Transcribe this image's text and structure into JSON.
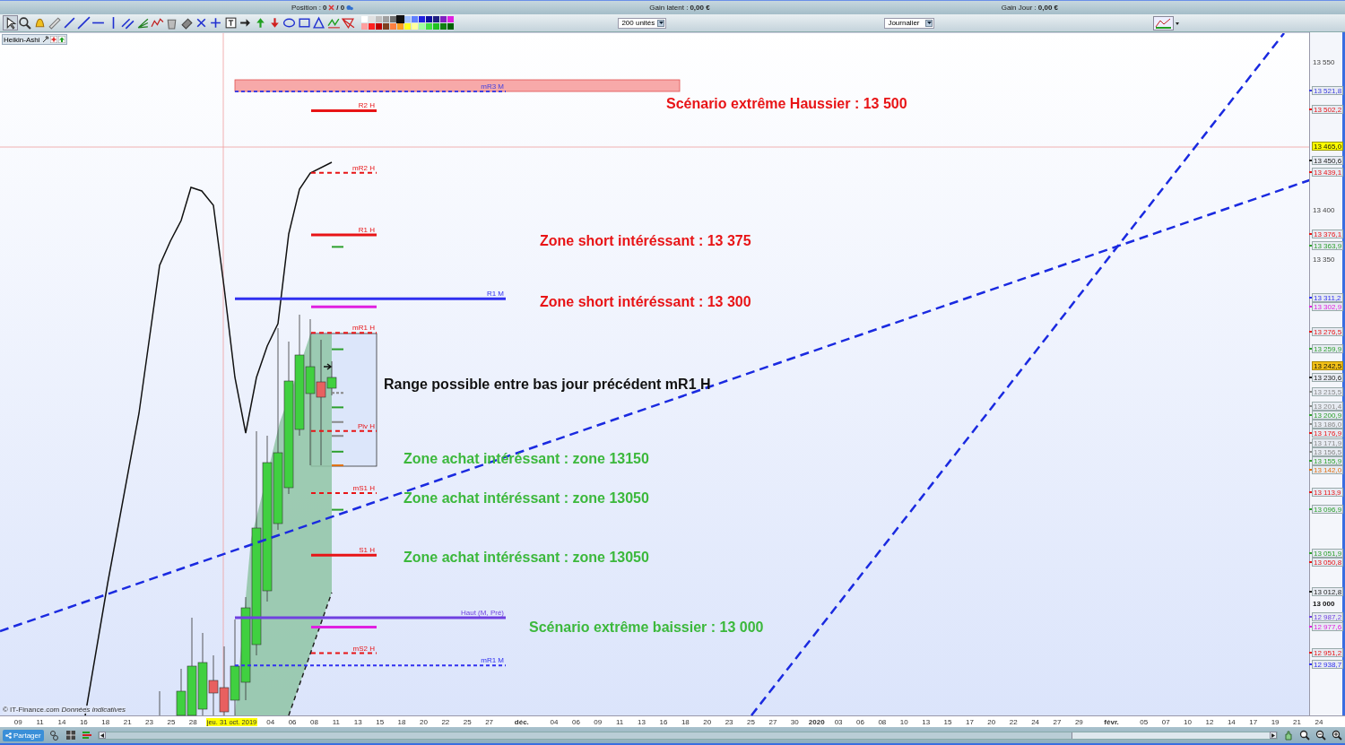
{
  "status": {
    "position_label": "Position :",
    "position_value": "0",
    "position_total": "/ 0",
    "gain_latent_label": "Gain latent :",
    "gain_latent_value": "0,00 €",
    "gain_jour_label": "Gain Jour :",
    "gain_jour_value": "0,00 €"
  },
  "palette": [
    {
      "color": "#ffffff",
      "selected": false
    },
    {
      "color": "#e0e0e0",
      "selected": false
    },
    {
      "color": "#c0c0c0",
      "selected": false
    },
    {
      "color": "#a0a0a0",
      "selected": false
    },
    {
      "color": "#707070",
      "selected": false
    },
    {
      "color": "#101010",
      "selected": true
    },
    {
      "color": "#a0c0ff",
      "selected": false
    },
    {
      "color": "#6080ff",
      "selected": false
    },
    {
      "color": "#2020e0",
      "selected": false
    },
    {
      "color": "#1010a0",
      "selected": false
    },
    {
      "color": "#202080",
      "selected": false
    },
    {
      "color": "#8020c0",
      "selected": false
    },
    {
      "color": "#e020e0",
      "selected": false
    },
    {
      "color": "#ffa0a0",
      "selected": false
    },
    {
      "color": "#ff2020",
      "selected": false
    },
    {
      "color": "#c00000",
      "selected": false
    },
    {
      "color": "#804020",
      "selected": false
    },
    {
      "color": "#ff8040",
      "selected": false
    },
    {
      "color": "#ffa020",
      "selected": false
    },
    {
      "color": "#ffff20",
      "selected": false
    },
    {
      "color": "#ffffa0",
      "selected": false
    },
    {
      "color": "#a0ffa0",
      "selected": false
    },
    {
      "color": "#40e040",
      "selected": false
    },
    {
      "color": "#20c020",
      "selected": false
    },
    {
      "color": "#108010",
      "selected": false
    },
    {
      "color": "#006000",
      "selected": false
    }
  ],
  "quantity_select": {
    "value": "200 unités"
  },
  "period_select": {
    "value": "Journalier"
  },
  "chart": {
    "tag": "Heikin-Ashi",
    "copyright": "© IT-Finance.com *Données indicatives*",
    "annotations": [
      {
        "text": "Scénario extrême Haussier : 13 500",
        "color": "#e81416"
      },
      {
        "text": "Zone short intéréssant : 13 375",
        "color": "#e81416"
      },
      {
        "text": "Zone short intéréssant : 13 300",
        "color": "#e81416"
      },
      {
        "text": "Range possible entre bas jour précédent mR1 H",
        "color": "#111111"
      },
      {
        "text": "Zone achat intéréssant : zone 13150",
        "color": "#3cb83c"
      },
      {
        "text": "Zone achat intéréssant : zone 13050",
        "color": "#3cb83c"
      },
      {
        "text": "Zone achat intéréssant : zone 13050",
        "color": "#3cb83c"
      },
      {
        "text": "Scénario extrême baissier : 13 000",
        "color": "#3cb83c"
      }
    ]
  },
  "price_axis": [
    {
      "label": "13 550",
      "kind": "tick"
    },
    {
      "label": "13 521,8",
      "kind": "label",
      "color": "#4040e0",
      "line": {
        "label": "mR3 M",
        "kind": "mdashed"
      }
    },
    {
      "label": "13 502,2",
      "kind": "label",
      "color": "#e81416",
      "line": {
        "label": "R2 H",
        "kind": "hsolid"
      }
    },
    {
      "label": "13 465,0",
      "kind": "cursor"
    },
    {
      "label": "13 450,6",
      "kind": "label",
      "color": "#222222"
    },
    {
      "label": "13 439,1",
      "kind": "label",
      "color": "#e81416",
      "line": {
        "label": "mR2 H",
        "kind": "hdashed"
      }
    },
    {
      "label": "13 400",
      "kind": "tick"
    },
    {
      "label": "13 376,1",
      "kind": "label",
      "color": "#e81416",
      "line": {
        "label": "R1 H",
        "kind": "hsolid"
      }
    },
    {
      "label": "13 363,9",
      "kind": "label",
      "color": "#2ca02c",
      "line": {
        "kind": "tick"
      }
    },
    {
      "label": "13 350",
      "kind": "tick"
    },
    {
      "label": "13 311,2",
      "kind": "label",
      "color": "#3030f0",
      "line": {
        "label": "R1 M",
        "kind": "msolid"
      }
    },
    {
      "label": "13 302,9",
      "kind": "label",
      "color": "#e020e0",
      "line": {
        "kind": "hsolid"
      }
    },
    {
      "label": "13 276,5",
      "kind": "label",
      "color": "#e81416",
      "line": {
        "label": "mR1 H",
        "kind": "hdashed"
      }
    },
    {
      "label": "13 259,9",
      "kind": "label",
      "color": "#2ca02c",
      "line": {
        "kind": "tick"
      }
    },
    {
      "label": "13 242,5",
      "kind": "last"
    },
    {
      "label": "13 230,6",
      "kind": "label",
      "color": "#222222"
    },
    {
      "label": "13 215,5",
      "kind": "label",
      "color": "#888888",
      "line": {
        "kind": "tickdashed"
      }
    },
    {
      "label": "13 201,4",
      "kind": "label",
      "color": "#888888"
    },
    {
      "label": "13 200,9",
      "kind": "label",
      "color": "#2ca02c",
      "line": {
        "kind": "tick"
      }
    },
    {
      "label": "13 186,0",
      "kind": "label",
      "color": "#888888",
      "line": {
        "kind": "tick"
      }
    },
    {
      "label": "13 176,9",
      "kind": "label",
      "color": "#e81416",
      "line": {
        "label": "Piv H",
        "kind": "hdashed"
      }
    },
    {
      "label": "13 171,9",
      "kind": "label",
      "color": "#888888",
      "line": {
        "kind": "tick"
      }
    },
    {
      "label": "13 156,5",
      "kind": "label",
      "color": "#888888"
    },
    {
      "label": "13 155,9",
      "kind": "label",
      "color": "#2ca02c",
      "line": {
        "kind": "tick"
      }
    },
    {
      "label": "13 142,0",
      "kind": "label",
      "color": "#e07010",
      "line": {
        "kind": "tick"
      }
    },
    {
      "label": "13 113,9",
      "kind": "label",
      "color": "#e81416",
      "line": {
        "label": "mS1 H",
        "kind": "hdashed"
      }
    },
    {
      "label": "13 096,9",
      "kind": "label",
      "color": "#2ca02c",
      "line": {
        "kind": "tick"
      }
    },
    {
      "label": "13 051,9",
      "kind": "label",
      "color": "#2ca02c"
    },
    {
      "label": "13 050,8",
      "kind": "label",
      "color": "#e81416",
      "line": {
        "label": "S1 H",
        "kind": "hsolid"
      }
    },
    {
      "label": "13 012,8",
      "kind": "label",
      "color": "#222222"
    },
    {
      "label": "13 000",
      "kind": "major"
    },
    {
      "label": "12 987,2",
      "kind": "label",
      "color": "#7040e0",
      "line": {
        "label": "Haut (M, Pré)",
        "kind": "msolid"
      }
    },
    {
      "label": "12 977,6",
      "kind": "label",
      "color": "#e020e0",
      "line": {
        "kind": "hsolid"
      }
    },
    {
      "label": "12 951,2",
      "kind": "label",
      "color": "#e81416",
      "line": {
        "label": "mS2 H",
        "kind": "hdashed"
      }
    },
    {
      "label": "12 938,7",
      "kind": "label",
      "color": "#3030f0",
      "line": {
        "label": "mR1 M",
        "kind": "mdashed"
      }
    }
  ],
  "date_axis": [
    {
      "label": "09",
      "kind": "day"
    },
    {
      "label": "11",
      "kind": "day"
    },
    {
      "label": "14",
      "kind": "day"
    },
    {
      "label": "16",
      "kind": "day"
    },
    {
      "label": "18",
      "kind": "day"
    },
    {
      "label": "21",
      "kind": "day"
    },
    {
      "label": "23",
      "kind": "day"
    },
    {
      "label": "25",
      "kind": "day"
    },
    {
      "label": "28",
      "kind": "day"
    },
    {
      "label": "jeu. 31 oct. 2019",
      "kind": "cursor"
    },
    {
      "label": "04",
      "kind": "day"
    },
    {
      "label": "06",
      "kind": "day"
    },
    {
      "label": "08",
      "kind": "day"
    },
    {
      "label": "11",
      "kind": "day"
    },
    {
      "label": "13",
      "kind": "day"
    },
    {
      "label": "15",
      "kind": "day"
    },
    {
      "label": "18",
      "kind": "day"
    },
    {
      "label": "20",
      "kind": "day"
    },
    {
      "label": "22",
      "kind": "day"
    },
    {
      "label": "25",
      "kind": "day"
    },
    {
      "label": "27",
      "kind": "day"
    },
    {
      "label": "déc.",
      "kind": "month"
    },
    {
      "label": "04",
      "kind": "day"
    },
    {
      "label": "06",
      "kind": "day"
    },
    {
      "label": "09",
      "kind": "day"
    },
    {
      "label": "11",
      "kind": "day"
    },
    {
      "label": "13",
      "kind": "day"
    },
    {
      "label": "16",
      "kind": "day"
    },
    {
      "label": "18",
      "kind": "day"
    },
    {
      "label": "20",
      "kind": "day"
    },
    {
      "label": "23",
      "kind": "day"
    },
    {
      "label": "25",
      "kind": "day"
    },
    {
      "label": "27",
      "kind": "day"
    },
    {
      "label": "30",
      "kind": "day"
    },
    {
      "label": "2020",
      "kind": "year"
    },
    {
      "label": "03",
      "kind": "day"
    },
    {
      "label": "06",
      "kind": "day"
    },
    {
      "label": "08",
      "kind": "day"
    },
    {
      "label": "10",
      "kind": "day"
    },
    {
      "label": "13",
      "kind": "day"
    },
    {
      "label": "15",
      "kind": "day"
    },
    {
      "label": "17",
      "kind": "day"
    },
    {
      "label": "20",
      "kind": "day"
    },
    {
      "label": "22",
      "kind": "day"
    },
    {
      "label": "24",
      "kind": "day"
    },
    {
      "label": "27",
      "kind": "day"
    },
    {
      "label": "29",
      "kind": "day"
    },
    {
      "label": "févr.",
      "kind": "month"
    },
    {
      "label": "05",
      "kind": "day"
    },
    {
      "label": "07",
      "kind": "day"
    },
    {
      "label": "10",
      "kind": "day"
    },
    {
      "label": "12",
      "kind": "day"
    },
    {
      "label": "14",
      "kind": "day"
    },
    {
      "label": "17",
      "kind": "day"
    },
    {
      "label": "19",
      "kind": "day"
    },
    {
      "label": "21",
      "kind": "day"
    },
    {
      "label": "24",
      "kind": "day"
    }
  ],
  "share_button": {
    "label": "Partager"
  }
}
